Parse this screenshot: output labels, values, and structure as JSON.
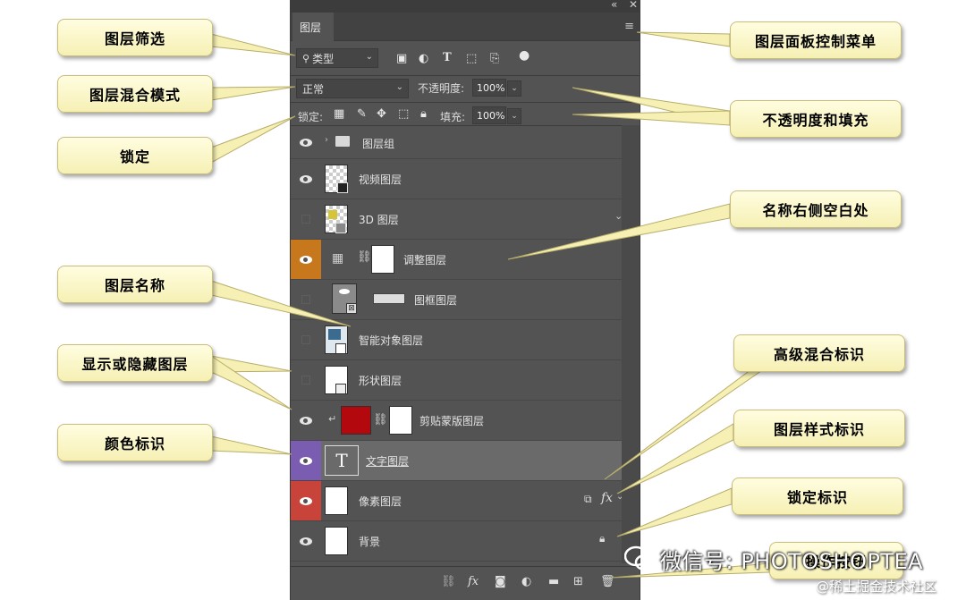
{
  "panel": {
    "tab_title": "图层",
    "filter": {
      "kind_label": "类型",
      "icons": [
        "image-filter-icon",
        "adjustment-filter-icon",
        "type-filter-icon",
        "shape-filter-icon",
        "smart-object-filter-icon",
        "filter-toggle-icon"
      ]
    },
    "blend_mode": "正常",
    "opacity_label": "不透明度:",
    "opacity_value": "100%",
    "lock_label": "锁定:",
    "fill_label": "填充:",
    "fill_value": "100%"
  },
  "layers": [
    {
      "name": "图层组",
      "visible": true,
      "kind": "group"
    },
    {
      "name": "视频图层",
      "visible": true,
      "kind": "video"
    },
    {
      "name": "3D 图层",
      "visible": false,
      "kind": "3d"
    },
    {
      "name": "调整图层",
      "visible": true,
      "kind": "adjustment",
      "color_tag": "#c8781c"
    },
    {
      "name": "图框图层",
      "visible": false,
      "kind": "frame"
    },
    {
      "name": "智能对象图层",
      "visible": false,
      "kind": "smart"
    },
    {
      "name": "形状图层",
      "visible": false,
      "kind": "shape"
    },
    {
      "name": "剪贴蒙版图层",
      "visible": true,
      "kind": "clip"
    },
    {
      "name": "文字图层",
      "visible": true,
      "kind": "type",
      "color_tag": "#7a5cb0",
      "selected": true
    },
    {
      "name": "像素图层",
      "visible": true,
      "kind": "pixel",
      "color_tag": "#c8443a"
    },
    {
      "name": "背景",
      "visible": true,
      "kind": "background"
    }
  ],
  "footer_icons": [
    "link-icon",
    "fx-icon",
    "mask-icon",
    "adjustment-icon",
    "folder-icon",
    "new-layer-icon",
    "trash-icon"
  ],
  "callouts": {
    "filter": "图层筛选",
    "blend": "图层混合模式",
    "lock": "锁定",
    "layer_name": "图层名称",
    "show_hide": "显示或隐藏图层",
    "color_tag": "颜色标识",
    "panel_menu": "图层面板控制菜单",
    "opacity_fill": "不透明度和填充",
    "name_right": "名称右侧空白处",
    "adv_blend": "高级混合标识",
    "layer_style": "图层样式标识",
    "lock_tag": "锁定标识",
    "ops_buttons": "操作按钮"
  },
  "watermark": {
    "text": "微信号: PHOTOSHOPTEA",
    "sub": "@稀土掘金技术社区"
  }
}
